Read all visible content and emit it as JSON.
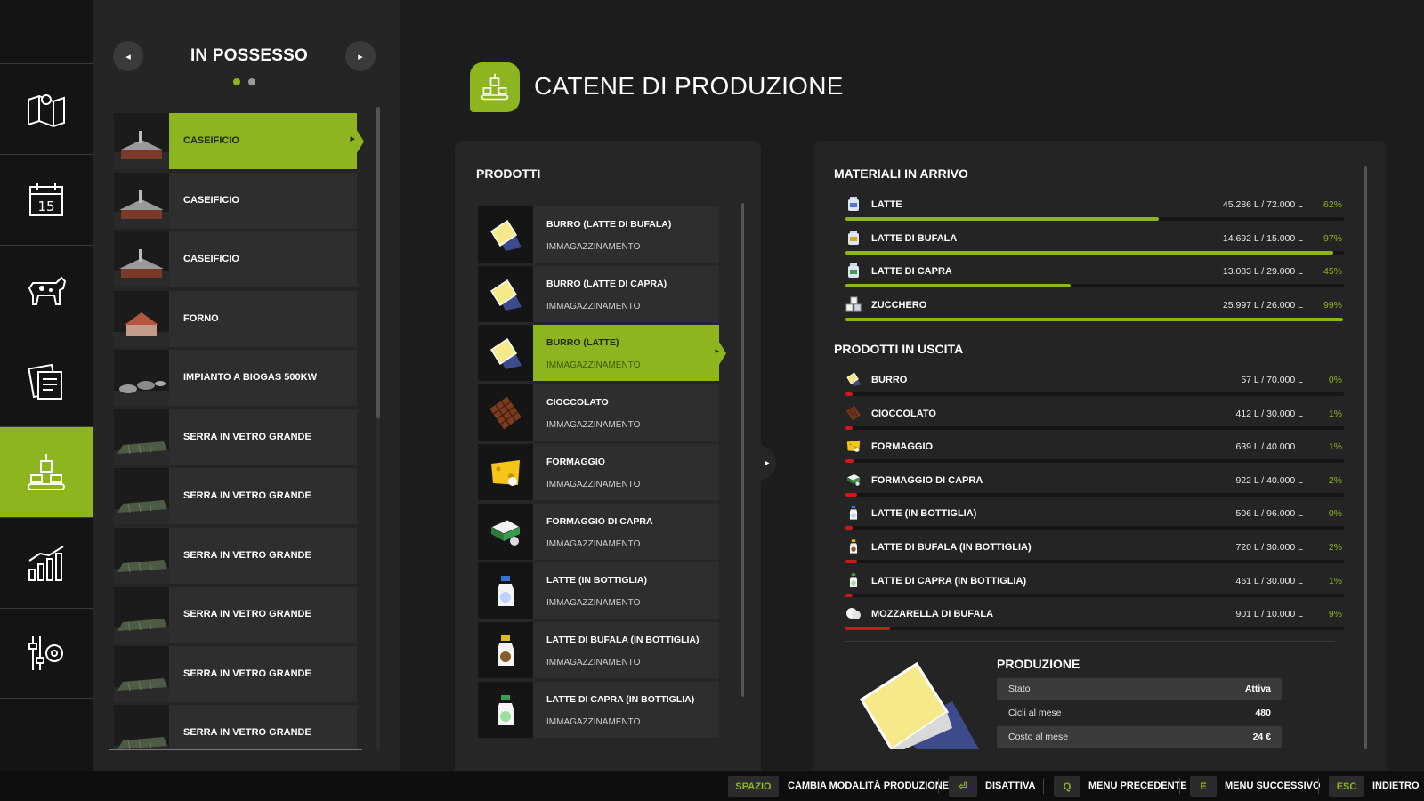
{
  "colors": {
    "accent": "#8cb520",
    "danger": "#d0181a",
    "panel": "#262626"
  },
  "nav": [
    {
      "icon": "map-icon",
      "active": false
    },
    {
      "icon": "calendar-icon",
      "active": false,
      "day": "15"
    },
    {
      "icon": "cow-icon",
      "active": false
    },
    {
      "icon": "contracts-icon",
      "active": false
    },
    {
      "icon": "production-icon",
      "active": true
    },
    {
      "icon": "statistics-icon",
      "active": false
    },
    {
      "icon": "settings-icon",
      "active": false
    }
  ],
  "owned": {
    "title": "IN POSSESSO",
    "prev_icon": "◂",
    "next_icon": "▸",
    "page_count": 2,
    "current_page": 1,
    "items": [
      {
        "name": "CASEIFICIO",
        "active": true,
        "thumb": "dairy-thumbnail"
      },
      {
        "name": "CASEIFICIO",
        "active": false,
        "thumb": "dairy-thumbnail"
      },
      {
        "name": "CASEIFICIO",
        "active": false,
        "thumb": "dairy-thumbnail"
      },
      {
        "name": "FORNO",
        "active": false,
        "thumb": "bakery-thumbnail"
      },
      {
        "name": "IMPIANTO A BIOGAS 500KW",
        "active": false,
        "thumb": "biogas-thumbnail"
      },
      {
        "name": "SERRA IN VETRO GRANDE",
        "active": false,
        "thumb": "greenhouse-thumbnail"
      },
      {
        "name": "SERRA IN VETRO GRANDE",
        "active": false,
        "thumb": "greenhouse-thumbnail"
      },
      {
        "name": "SERRA IN VETRO GRANDE",
        "active": false,
        "thumb": "greenhouse-thumbnail"
      },
      {
        "name": "SERRA IN VETRO GRANDE",
        "active": false,
        "thumb": "greenhouse-thumbnail"
      },
      {
        "name": "SERRA IN VETRO GRANDE",
        "active": false,
        "thumb": "greenhouse-thumbnail"
      },
      {
        "name": "SERRA IN VETRO GRANDE",
        "active": false,
        "thumb": "greenhouse-thumbnail"
      }
    ]
  },
  "header": {
    "title": "CATENE DI PRODUZIONE",
    "icon": "production-chain-icon"
  },
  "products": {
    "title": "PRODOTTI",
    "items": [
      {
        "name": "BURRO (LATTE DI BUFALA)",
        "sub": "IMMAGAZZINAMENTO",
        "icon": "butter-icon",
        "active": false
      },
      {
        "name": "BURRO (LATTE DI CAPRA)",
        "sub": "IMMAGAZZINAMENTO",
        "icon": "butter-icon",
        "active": false
      },
      {
        "name": "BURRO (LATTE)",
        "sub": "IMMAGAZZINAMENTO",
        "icon": "butter-icon",
        "active": true
      },
      {
        "name": "CIOCCOLATO",
        "sub": "IMMAGAZZINAMENTO",
        "icon": "chocolate-icon",
        "active": false
      },
      {
        "name": "FORMAGGIO",
        "sub": "IMMAGAZZINAMENTO",
        "icon": "cheese-icon",
        "active": false
      },
      {
        "name": "FORMAGGIO DI CAPRA",
        "sub": "IMMAGAZZINAMENTO",
        "icon": "goat-cheese-icon",
        "active": false
      },
      {
        "name": "LATTE (IN BOTTIGLIA)",
        "sub": "IMMAGAZZINAMENTO",
        "icon": "milk-bottle-icon",
        "active": false
      },
      {
        "name": "LATTE DI BUFALA (IN BOTTIGLIA)",
        "sub": "IMMAGAZZINAMENTO",
        "icon": "buffalo-milk-bottle-icon",
        "active": false
      },
      {
        "name": "LATTE DI CAPRA (IN BOTTIGLIA)",
        "sub": "IMMAGAZZINAMENTO",
        "icon": "goat-milk-bottle-icon",
        "active": false
      }
    ]
  },
  "incoming": {
    "title": "MATERIALI IN ARRIVO",
    "items": [
      {
        "name": "LATTE",
        "value": "45.286 L / 72.000 L",
        "pct": "62%",
        "fraction": 0.629,
        "icon": "milk-can-icon"
      },
      {
        "name": "LATTE DI BUFALA",
        "value": "14.692 L / 15.000 L",
        "pct": "97%",
        "fraction": 0.979,
        "icon": "buffalo-milk-can-icon"
      },
      {
        "name": "LATTE DI CAPRA",
        "value": "13.083 L / 29.000 L",
        "pct": "45%",
        "fraction": 0.451,
        "icon": "goat-milk-can-icon"
      },
      {
        "name": "ZUCCHERO",
        "value": "25.997 L / 26.000 L",
        "pct": "99%",
        "fraction": 0.999,
        "icon": "sugar-icon"
      }
    ]
  },
  "outgoing": {
    "title": "PRODOTTI IN USCITA",
    "items": [
      {
        "name": "BURRO",
        "value": "57 L / 70.000 L",
        "pct": "0%",
        "fraction": 0.001,
        "icon": "butter-icon"
      },
      {
        "name": "CIOCCOLATO",
        "value": "412 L / 30.000 L",
        "pct": "1%",
        "fraction": 0.014,
        "icon": "chocolate-icon"
      },
      {
        "name": "FORMAGGIO",
        "value": "639 L / 40.000 L",
        "pct": "1%",
        "fraction": 0.016,
        "icon": "cheese-icon"
      },
      {
        "name": "FORMAGGIO DI CAPRA",
        "value": "922 L / 40.000 L",
        "pct": "2%",
        "fraction": 0.023,
        "icon": "goat-cheese-icon"
      },
      {
        "name": "LATTE (IN BOTTIGLIA)",
        "value": "506 L / 96.000 L",
        "pct": "0%",
        "fraction": 0.005,
        "icon": "milk-bottle-icon"
      },
      {
        "name": "LATTE DI BUFALA (IN BOTTIGLIA)",
        "value": "720 L / 30.000 L",
        "pct": "2%",
        "fraction": 0.024,
        "icon": "buffalo-milk-bottle-icon"
      },
      {
        "name": "LATTE DI CAPRA (IN BOTTIGLIA)",
        "value": "461 L / 30.000 L",
        "pct": "1%",
        "fraction": 0.015,
        "icon": "goat-milk-bottle-icon"
      },
      {
        "name": "MOZZARELLA DI BUFALA",
        "value": "901 L / 10.000 L",
        "pct": "9%",
        "fraction": 0.09,
        "icon": "mozzarella-icon"
      }
    ]
  },
  "production": {
    "title": "PRODUZIONE",
    "image": "butter-product-image",
    "stats": [
      {
        "label": "Stato",
        "value": "Attiva"
      },
      {
        "label": "Cicli al mese",
        "value": "480"
      },
      {
        "label": "Costo al mese",
        "value": "24 €"
      }
    ]
  },
  "bottombar": [
    {
      "key": "SPAZIO",
      "label": "CAMBIA MODALITÀ PRODUZIONE"
    },
    {
      "key": "⏎",
      "label": "DISATTIVA"
    },
    {
      "key": "Q",
      "label": "MENU PRECEDENTE"
    },
    {
      "key": "E",
      "label": "MENU SUCCESSIVO"
    },
    {
      "key": "ESC",
      "label": "INDIETRO"
    }
  ]
}
